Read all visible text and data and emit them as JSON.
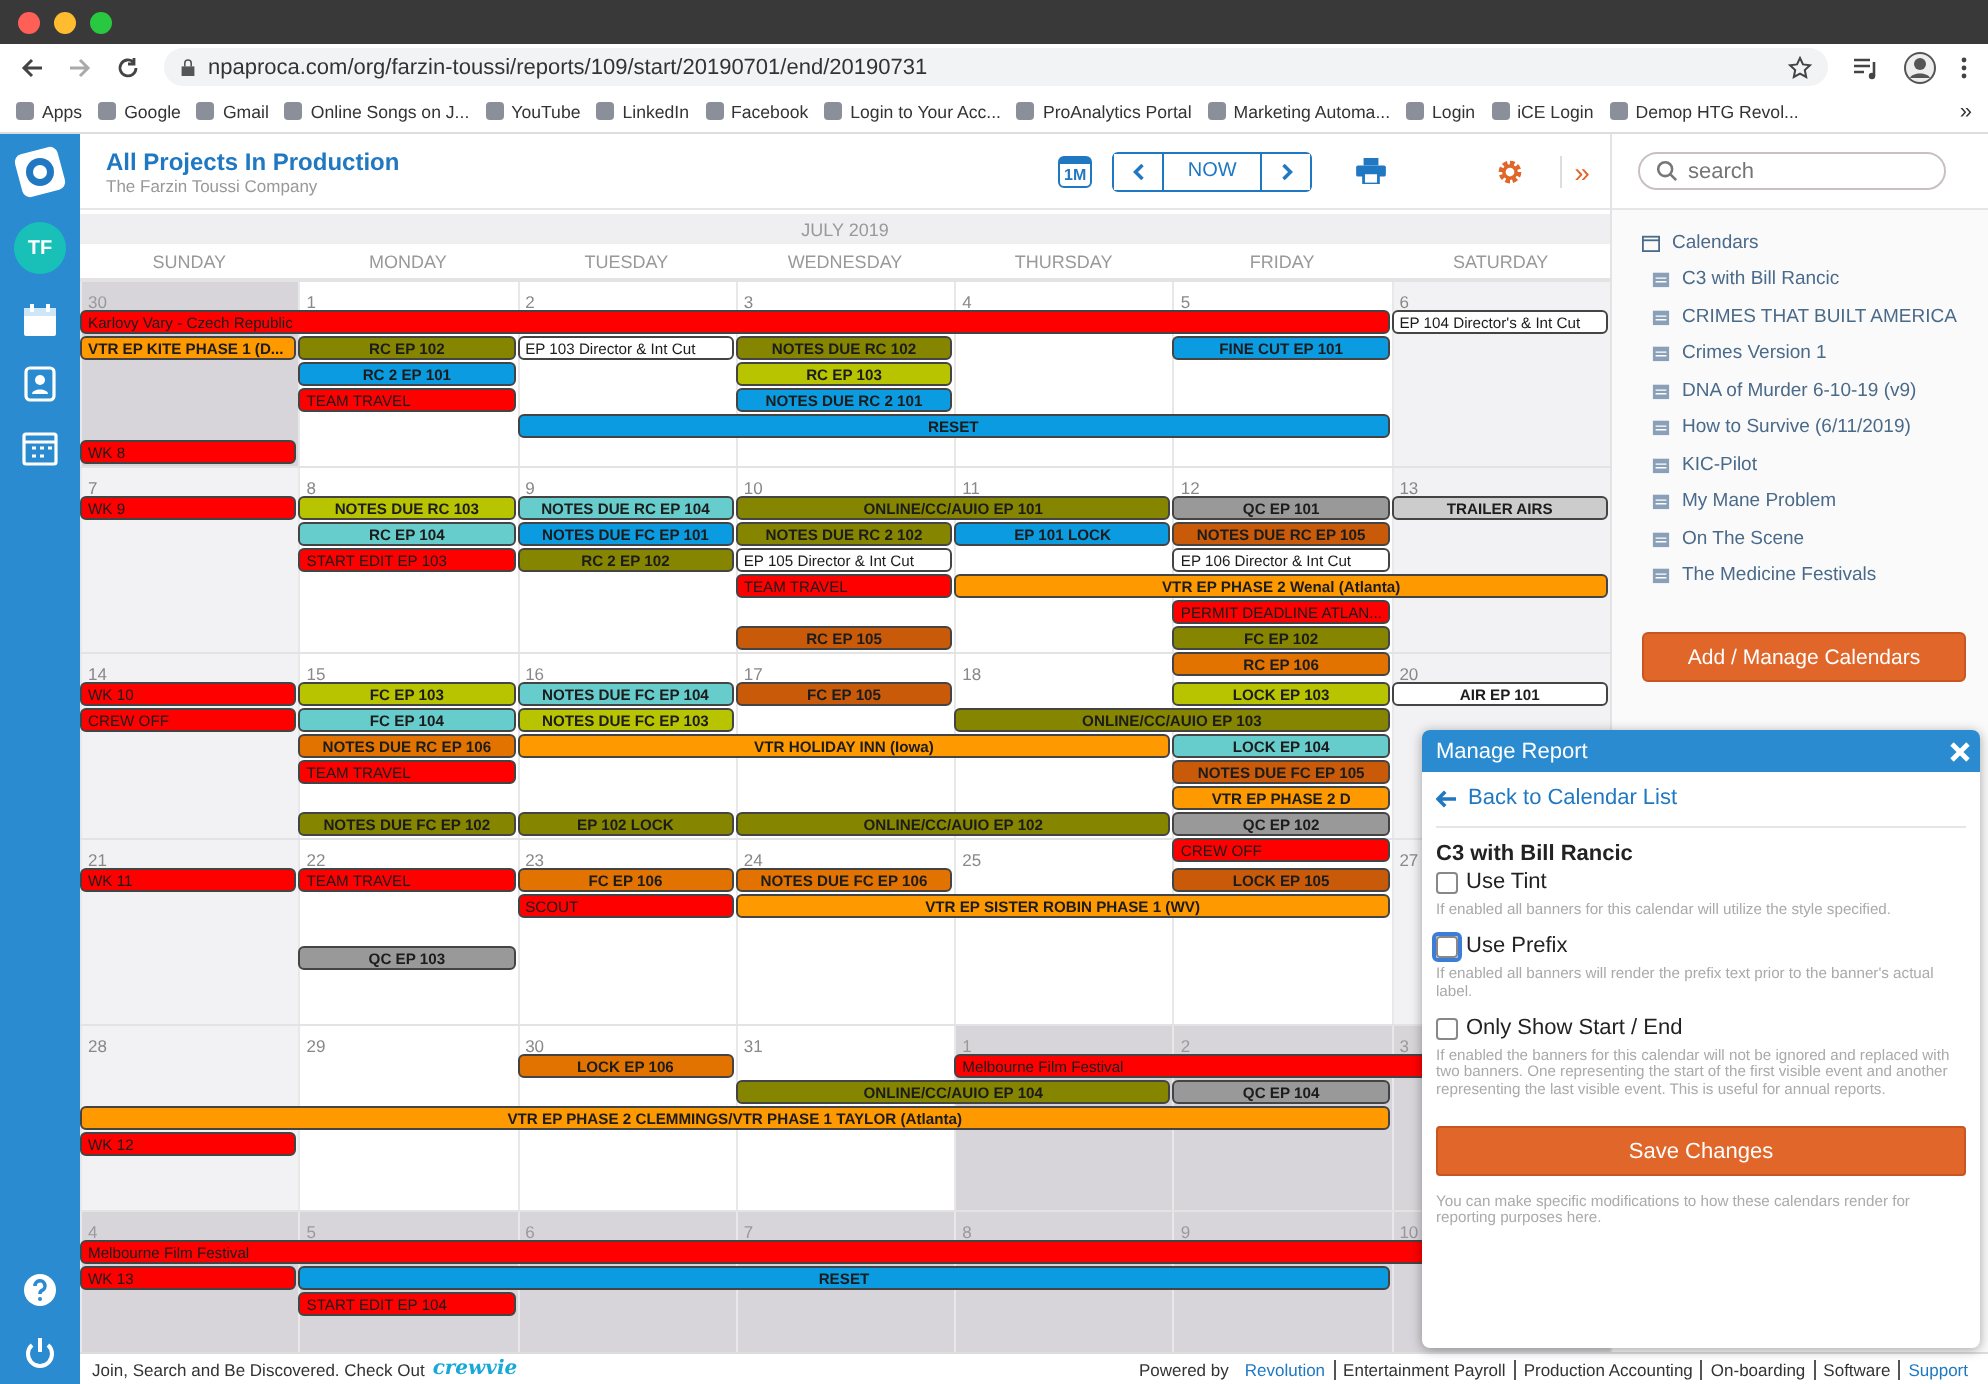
{
  "browser": {
    "url": "npaproca.com/org/farzin-toussi/reports/109/start/20190701/end/20190731",
    "bookmarks": [
      "Apps",
      "Google",
      "Gmail",
      "Online Songs on J...",
      "YouTube",
      "LinkedIn",
      "Facebook",
      "Login to Your Acc...",
      "ProAnalytics Portal",
      "Marketing Automa...",
      "Login",
      "iCE Login",
      "Demop HTG Revol..."
    ],
    "more": "»"
  },
  "sidebar": {
    "avatar": "TF"
  },
  "header": {
    "title": "All Projects In Production",
    "subtitle": "The Farzin Toussi Company",
    "view_badge": "1M",
    "today_button": "NOW",
    "expand": "»"
  },
  "calendar": {
    "month": "JULY 2019",
    "weekdays": [
      "SUNDAY",
      "MONDAY",
      "TUESDAY",
      "WEDNESDAY",
      "THURSDAY",
      "FRIDAY",
      "SATURDAY"
    ],
    "weeks": [
      {
        "days": [
          {
            "number": "30",
            "outside": true
          },
          {
            "number": "1",
            "outside": false
          },
          {
            "number": "2",
            "outside": false
          },
          {
            "number": "3",
            "outside": false
          },
          {
            "number": "4",
            "outside": false
          },
          {
            "number": "5",
            "outside": false
          },
          {
            "number": "6",
            "outside": false
          }
        ],
        "lanes": [
          [
            {
              "text": "Karlovy Vary - Czech Republic",
              "color": "#ff0000",
              "kind": "note"
            },
            {
              "kind": "cont"
            },
            {
              "kind": "cont"
            },
            {
              "kind": "cont"
            },
            {
              "kind": "cont"
            },
            {
              "kind": "cont"
            },
            {
              "text": "EP 104 Director's & Int Cut",
              "color": "#ffffff",
              "kind": "note"
            }
          ],
          [
            {
              "text": "VTR EP KITE PHASE 1 (D...",
              "color": "#ff9900",
              "kind": "flag"
            },
            {
              "text": "RC EP 102",
              "color": "#858500",
              "kind": "banner"
            },
            {
              "text": "EP 103 Director & Int Cut",
              "color": "#ffffff",
              "kind": "note"
            },
            {
              "text": "NOTES DUE RC 102",
              "color": "#858500",
              "kind": "banner"
            },
            {
              "kind": "gap"
            },
            {
              "text": "FINE CUT EP 101",
              "color": "#0a9be0",
              "kind": "banner"
            }
          ],
          [
            {
              "kind": "gap"
            },
            {
              "text": "RC 2 EP 101",
              "color": "#0a9be0",
              "kind": "banner"
            },
            {
              "kind": "gap"
            },
            {
              "text": "RC EP 103",
              "color": "#b8c400",
              "kind": "banner"
            }
          ],
          [
            {
              "kind": "gap"
            },
            {
              "text": "TEAM TRAVEL",
              "color": "#ff0000",
              "kind": "note"
            },
            {
              "kind": "gap"
            },
            {
              "text": "NOTES DUE RC 2 101",
              "color": "#0a9be0",
              "kind": "banner"
            }
          ],
          [
            {
              "kind": "gap"
            },
            {
              "kind": "gap"
            },
            {
              "text": "RESET",
              "color": "#0a9be0",
              "kind": "banner"
            },
            {
              "kind": "cont"
            },
            {
              "kind": "cont"
            },
            {
              "kind": "cont"
            }
          ],
          [
            {
              "text": "WK 8",
              "color": "#ff0000",
              "kind": "note"
            }
          ]
        ]
      },
      {
        "days": [
          {
            "number": "7",
            "outside": false
          },
          {
            "number": "8",
            "outside": false
          },
          {
            "number": "9",
            "outside": false
          },
          {
            "number": "10",
            "outside": false
          },
          {
            "number": "11",
            "outside": false
          },
          {
            "number": "12",
            "outside": false
          },
          {
            "number": "13",
            "outside": false
          }
        ],
        "lanes": [
          [
            {
              "text": "WK 9",
              "color": "#ff0000",
              "kind": "note"
            },
            {
              "text": "NOTES DUE RC 103",
              "color": "#b8c400",
              "kind": "banner"
            },
            {
              "text": "NOTES DUE RC EP 104",
              "color": "#66cccc",
              "kind": "banner"
            },
            {
              "text": "ONLINE/CC/AUIO EP 101",
              "color": "#858500",
              "kind": "banner"
            },
            {
              "kind": "cont"
            },
            {
              "text": "QC EP 101",
              "color": "#999999",
              "kind": "banner"
            },
            {
              "text": "TRAILER AIRS",
              "color": "#cccccc",
              "kind": "banner"
            }
          ],
          [
            {
              "kind": "gap"
            },
            {
              "text": "RC EP 104",
              "color": "#66cccc",
              "kind": "banner"
            },
            {
              "text": "NOTES DUE FC EP 101",
              "color": "#0a9be0",
              "kind": "banner"
            },
            {
              "text": "NOTES DUE RC 2 102",
              "color": "#858500",
              "kind": "banner"
            },
            {
              "text": "EP 101 LOCK",
              "color": "#0a9be0",
              "kind": "banner"
            },
            {
              "text": "NOTES DUE RC EP 105",
              "color": "#c85a0a",
              "kind": "banner"
            }
          ],
          [
            {
              "kind": "gap"
            },
            {
              "text": "START EDIT EP 103",
              "color": "#ff0000",
              "kind": "note"
            },
            {
              "text": "RC 2 EP 102",
              "color": "#858500",
              "kind": "banner"
            },
            {
              "text": "EP 105 Director & Int Cut",
              "color": "#ffffff",
              "kind": "note"
            },
            {
              "kind": "gap"
            },
            {
              "text": "EP 106 Director & Int Cut",
              "color": "#ffffff",
              "kind": "note"
            }
          ],
          [
            {
              "kind": "gap"
            },
            {
              "kind": "gap"
            },
            {
              "kind": "gap"
            },
            {
              "text": "TEAM TRAVEL",
              "color": "#ff0000",
              "kind": "note"
            },
            {
              "text": "VTR EP PHASE 2 Wenal (Atlanta)",
              "color": "#ff9900",
              "kind": "banner"
            },
            {
              "kind": "cont"
            },
            {
              "kind": "cont"
            }
          ],
          [
            {
              "kind": "gap"
            },
            {
              "kind": "gap"
            },
            {
              "kind": "gap"
            },
            {
              "kind": "gap"
            },
            {
              "kind": "gap"
            },
            {
              "text": "PERMIT DEADLINE ATLAN...",
              "color": "#ff0000",
              "kind": "note"
            }
          ],
          [
            {
              "kind": "gap"
            },
            {
              "kind": "gap"
            },
            {
              "kind": "gap"
            },
            {
              "text": "RC EP 105",
              "color": "#c85a0a",
              "kind": "banner"
            },
            {
              "kind": "gap"
            },
            {
              "text": "FC EP 102",
              "color": "#858500",
              "kind": "banner"
            }
          ],
          [
            {
              "kind": "gap"
            },
            {
              "kind": "gap"
            },
            {
              "kind": "gap"
            },
            {
              "kind": "gap"
            },
            {
              "kind": "gap"
            },
            {
              "text": "RC EP 106",
              "color": "#e27300",
              "kind": "banner"
            }
          ]
        ]
      },
      {
        "days": [
          {
            "number": "14",
            "outside": false
          },
          {
            "number": "15",
            "outside": false
          },
          {
            "number": "16",
            "outside": false
          },
          {
            "number": "17",
            "outside": false
          },
          {
            "number": "18",
            "outside": false
          },
          {
            "outside": false
          },
          {
            "number": "20",
            "outside": false
          }
        ],
        "lanes": [
          [
            {
              "text": "WK 10",
              "color": "#ff0000",
              "kind": "note"
            },
            {
              "text": "FC EP 103",
              "color": "#b8c400",
              "kind": "banner"
            },
            {
              "text": "NOTES DUE FC EP 104",
              "color": "#66cccc",
              "kind": "banner"
            },
            {
              "text": "FC EP 105",
              "color": "#c85a0a",
              "kind": "banner"
            },
            {
              "kind": "gap"
            },
            {
              "text": "LOCK EP 103",
              "color": "#b8c400",
              "kind": "banner"
            },
            {
              "text": "AIR EP 101",
              "color": "#ffffff",
              "kind": "banner"
            }
          ],
          [
            {
              "text": "CREW OFF",
              "color": "#ff0000",
              "kind": "note"
            },
            {
              "text": "FC EP 104",
              "color": "#66cccc",
              "kind": "banner"
            },
            {
              "text": "NOTES DUE FC EP 103",
              "color": "#b8c400",
              "kind": "banner"
            },
            {
              "kind": "gap"
            },
            {
              "text": "ONLINE/CC/AUIO EP 103",
              "color": "#858500",
              "kind": "banner"
            },
            {
              "kind": "cont"
            }
          ],
          [
            {
              "kind": "gap"
            },
            {
              "text": "NOTES DUE RC EP 106",
              "color": "#e27300",
              "kind": "banner"
            },
            {
              "text": "VTR HOLIDAY INN (Iowa)",
              "color": "#ff9900",
              "kind": "banner"
            },
            {
              "kind": "cont"
            },
            {
              "kind": "cont"
            },
            {
              "text": "LOCK EP 104",
              "color": "#66cccc",
              "kind": "banner"
            }
          ],
          [
            {
              "kind": "gap"
            },
            {
              "text": "TEAM TRAVEL",
              "color": "#ff0000",
              "kind": "note"
            },
            {
              "kind": "gap"
            },
            {
              "kind": "gap"
            },
            {
              "kind": "gap"
            },
            {
              "text": "NOTES DUE FC EP 105",
              "color": "#c85a0a",
              "kind": "banner"
            }
          ],
          [
            {
              "kind": "gap"
            },
            {
              "kind": "gap"
            },
            {
              "kind": "gap"
            },
            {
              "kind": "gap"
            },
            {
              "kind": "gap"
            },
            {
              "text": "VTR EP PHASE 2 D",
              "color": "#ff9900",
              "kind": "banner"
            }
          ],
          [
            {
              "kind": "gap"
            },
            {
              "text": "NOTES DUE FC EP 102",
              "color": "#858500",
              "kind": "banner"
            },
            {
              "text": "EP 102 LOCK",
              "color": "#858500",
              "kind": "banner"
            },
            {
              "text": "ONLINE/CC/AUIO EP 102",
              "color": "#858500",
              "kind": "banner"
            },
            {
              "kind": "cont"
            },
            {
              "text": "QC EP 102",
              "color": "#999999",
              "kind": "banner"
            }
          ],
          [
            {
              "kind": "gap"
            },
            {
              "kind": "gap"
            },
            {
              "kind": "gap"
            },
            {
              "kind": "gap"
            },
            {
              "kind": "gap"
            },
            {
              "text": "CREW OFF",
              "color": "#ff0000",
              "kind": "note"
            }
          ]
        ]
      },
      {
        "days": [
          {
            "number": "21",
            "outside": false
          },
          {
            "number": "22",
            "outside": false
          },
          {
            "number": "23",
            "outside": false
          },
          {
            "number": "24",
            "outside": false
          },
          {
            "number": "25",
            "outside": false
          },
          {
            "outside": false
          },
          {
            "number": "27",
            "outside": false
          }
        ],
        "lanes": [
          [
            {
              "text": "WK 11",
              "color": "#ff0000",
              "kind": "note"
            },
            {
              "text": "TEAM TRAVEL",
              "color": "#ff0000",
              "kind": "note"
            },
            {
              "text": "FC EP 106",
              "color": "#e27300",
              "kind": "banner"
            },
            {
              "text": "NOTES DUE FC EP 106",
              "color": "#e27300",
              "kind": "banner"
            },
            {
              "kind": "gap"
            },
            {
              "text": "LOCK EP 105",
              "color": "#c85a0a",
              "kind": "banner"
            }
          ],
          [
            {
              "kind": "gap"
            },
            {
              "kind": "gap"
            },
            {
              "text": "SCOUT",
              "color": "#ff0000",
              "kind": "note"
            },
            {
              "text": "VTR EP SISTER ROBIN PHASE 1 (WV)",
              "color": "#ff9900",
              "kind": "banner"
            },
            {
              "kind": "cont"
            },
            {
              "kind": "cont"
            }
          ],
          [
            {
              "kind": "gap"
            }
          ],
          [
            {
              "kind": "gap"
            },
            {
              "text": "QC EP 103",
              "color": "#999999",
              "kind": "banner"
            }
          ]
        ]
      },
      {
        "days": [
          {
            "number": "28",
            "outside": false
          },
          {
            "number": "29",
            "outside": false
          },
          {
            "number": "30",
            "outside": false
          },
          {
            "number": "31",
            "outside": false
          },
          {
            "number": "1",
            "outside": true
          },
          {
            "number": "2",
            "outside": true
          },
          {
            "number": "3",
            "outside": true
          }
        ],
        "lanes": [
          [
            {
              "kind": "gap"
            },
            {
              "kind": "gap"
            },
            {
              "text": "LOCK EP 106",
              "color": "#e27300",
              "kind": "banner"
            },
            {
              "kind": "gap"
            },
            {
              "text": "Melbourne Film Festival",
              "color": "#ff0000",
              "kind": "note"
            },
            {
              "kind": "cont"
            },
            {
              "kind": "cont"
            }
          ],
          [
            {
              "kind": "gap"
            },
            {
              "kind": "gap"
            },
            {
              "kind": "gap"
            },
            {
              "text": "ONLINE/CC/AUIO EP 104",
              "color": "#858500",
              "kind": "banner"
            },
            {
              "kind": "cont"
            },
            {
              "text": "QC EP 104",
              "color": "#999999",
              "kind": "banner"
            }
          ],
          [
            {
              "text": "VTR EP PHASE 2 CLEMMINGS/VTR PHASE 1 TAYLOR (Atlanta)",
              "color": "#ff9900",
              "kind": "banner"
            },
            {
              "kind": "cont"
            },
            {
              "kind": "cont"
            },
            {
              "kind": "cont"
            },
            {
              "kind": "cont"
            },
            {
              "kind": "cont"
            }
          ],
          [
            {
              "text": "WK 12",
              "color": "#ff0000",
              "kind": "note"
            }
          ]
        ]
      },
      {
        "days": [
          {
            "number": "4",
            "outside": true
          },
          {
            "number": "5",
            "outside": true
          },
          {
            "number": "6",
            "outside": true
          },
          {
            "number": "7",
            "outside": true
          },
          {
            "number": "8",
            "outside": true
          },
          {
            "number": "9",
            "outside": true
          },
          {
            "number": "10",
            "outside": true
          }
        ],
        "lanes": [
          [
            {
              "text": "Melbourne Film Festival",
              "color": "#ff0000",
              "kind": "note"
            },
            {
              "kind": "cont"
            },
            {
              "kind": "cont"
            },
            {
              "kind": "cont"
            },
            {
              "kind": "cont"
            },
            {
              "kind": "cont"
            },
            {
              "kind": "cont"
            }
          ],
          [
            {
              "text": "WK 13",
              "color": "#ff0000",
              "kind": "note"
            },
            {
              "text": "RESET",
              "color": "#0a9be0",
              "kind": "banner"
            },
            {
              "kind": "cont"
            },
            {
              "kind": "cont"
            },
            {
              "kind": "cont"
            },
            {
              "kind": "cont"
            }
          ],
          [
            {
              "kind": "gap"
            },
            {
              "text": "START EDIT EP 104",
              "color": "#ff0000",
              "kind": "note"
            }
          ]
        ]
      }
    ]
  },
  "right_panel": {
    "search": {
      "placeholder": "search"
    },
    "tree": {
      "label": "Calendars",
      "children": [
        {
          "label": "C3 with Bill Rancic"
        },
        {
          "label": "CRIMES THAT BUILT AMERICA"
        },
        {
          "label": "Crimes Version 1"
        },
        {
          "label": "DNA of Murder 6-10-19 (v9)"
        },
        {
          "label": "How to Survive (6/11/2019)"
        },
        {
          "label": "KIC-Pilot"
        },
        {
          "label": "My Mane Problem"
        },
        {
          "label": "On The Scene"
        },
        {
          "label": "The Medicine Festivals"
        }
      ]
    },
    "add_button": "Add / Manage Calendars"
  },
  "modal": {
    "title": "Manage Report",
    "back_link": "Back to Calendar List",
    "heading": "C3 with Bill Rancic",
    "options": [
      {
        "label": "Use Tint",
        "checked": false,
        "hint": "If enabled all banners for this calendar will utilize the style specified."
      },
      {
        "label": "Use Prefix",
        "checked": false,
        "focused": true,
        "hint": "If enabled all banners will render the prefix text prior to the banner's actual label."
      },
      {
        "label": "Only Show Start / End",
        "checked": false,
        "hint": "If enabled the banners for this calendar will not be ignored and replaced with two banners. One representing the start of the first visible event and another representing the last visible event. This is useful for annual reports."
      }
    ],
    "save_button": "Save Changes",
    "note": "You can make specific modifications to how these calendars render for reporting purposes here."
  },
  "footer": {
    "text": "Join, Search and Be Discovered. Check Out",
    "brand": "crewvie",
    "powered_by": "Powered by",
    "links": [
      {
        "text": "Revolution",
        "highlighted": true
      },
      {
        "text": "Entertainment Payroll",
        "highlighted": false
      },
      {
        "text": "Production Accounting",
        "highlighted": false
      },
      {
        "text": "On-boarding",
        "highlighted": false
      },
      {
        "text": "Software",
        "highlighted": false
      },
      {
        "text": "Support",
        "highlighted": true
      }
    ]
  }
}
